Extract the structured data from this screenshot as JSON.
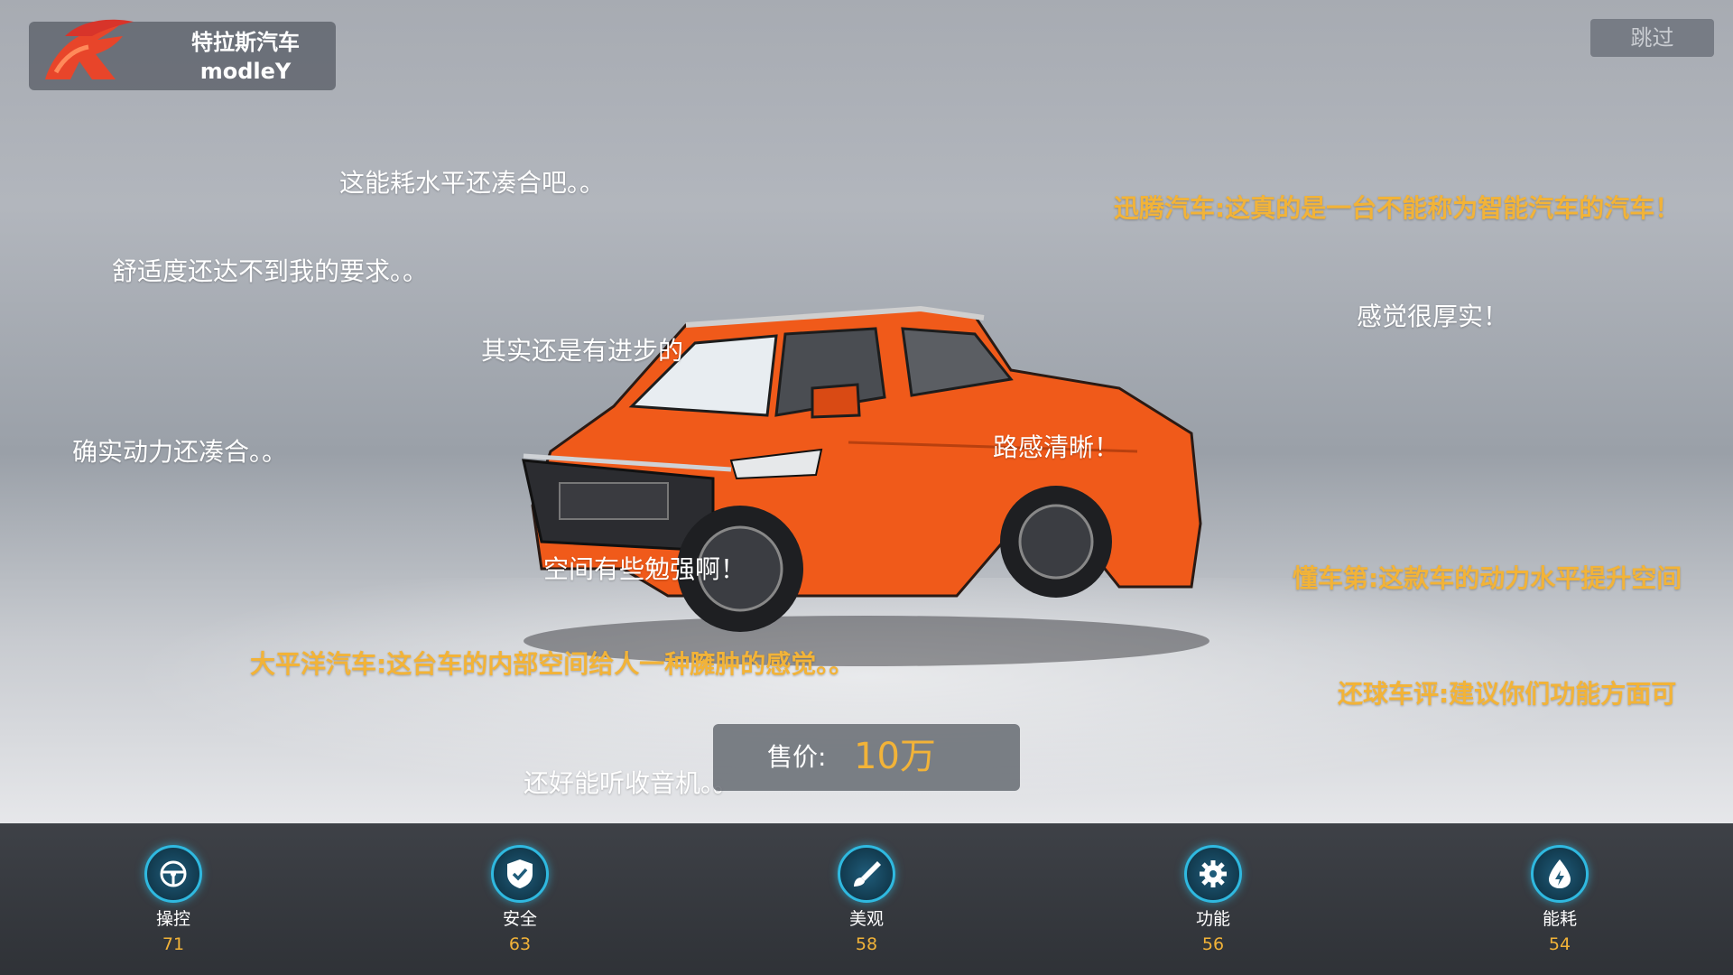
{
  "brand": {
    "name": "特拉斯汽车",
    "model": "modleY"
  },
  "skip_label": "跳过",
  "comments": {
    "c1": "这能耗水平还凑合吧。。",
    "c2": "舒适度还达不到我的要求。。",
    "c3": "其实还是有进步的",
    "c4": "确实动力还凑合。。",
    "c5": "路感清晰！",
    "c6": "空间有些勉强啊！",
    "c7": "还好能听收音机。。",
    "c8": "感觉很厚实！",
    "r1": "迅腾汽车:这真的是一台不能称为智能汽车的汽车！",
    "r2": "懂车第:这款车的动力水平提升空间",
    "r3": "还球车评:建议你们功能方面可",
    "r4": "大平洋汽车:这台车的内部空间给人一种臃肿的感觉。。"
  },
  "price": {
    "label": "售价:",
    "value": "10万"
  },
  "stats": [
    {
      "label": "操控",
      "value": "71",
      "icon": "steering-wheel-icon"
    },
    {
      "label": "安全",
      "value": "63",
      "icon": "shield-check-icon"
    },
    {
      "label": "美观",
      "value": "58",
      "icon": "brush-icon"
    },
    {
      "label": "功能",
      "value": "56",
      "icon": "gear-icon"
    },
    {
      "label": "能耗",
      "value": "54",
      "icon": "energy-drop-icon"
    }
  ],
  "colors": {
    "accent": "#f2b338",
    "car": "#f05a1a",
    "icon_ring": "#2fb9e0"
  }
}
